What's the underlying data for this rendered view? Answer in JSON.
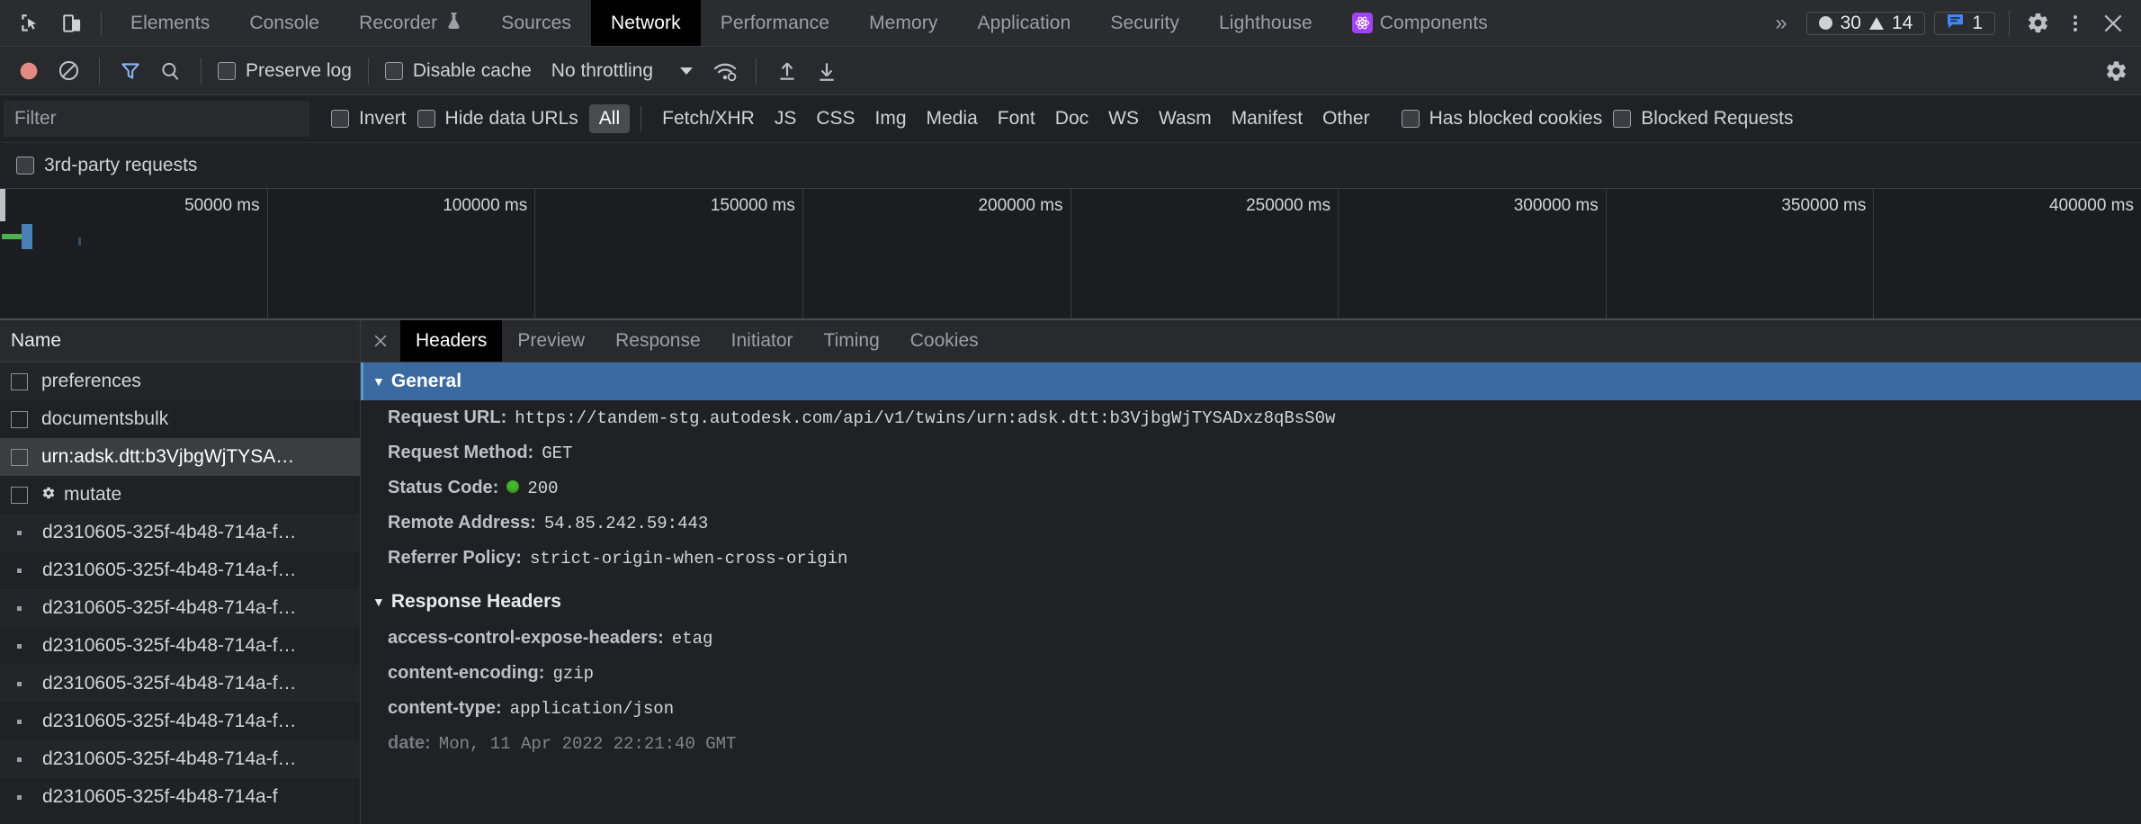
{
  "toolbar": {
    "inspect_icon": "inspect-element-icon",
    "device_icon": "device-toolbar-icon",
    "tabs": [
      {
        "label": "Elements",
        "selected": false
      },
      {
        "label": "Console",
        "selected": false
      },
      {
        "label": "Recorder",
        "selected": false,
        "badge": "flask-icon"
      },
      {
        "label": "Sources",
        "selected": false
      },
      {
        "label": "Network",
        "selected": true
      },
      {
        "label": "Performance",
        "selected": false
      },
      {
        "label": "Memory",
        "selected": false
      },
      {
        "label": "Application",
        "selected": false
      },
      {
        "label": "Security",
        "selected": false
      },
      {
        "label": "Lighthouse",
        "selected": false
      },
      {
        "label": "Components",
        "selected": false,
        "icon": "react-components-icon"
      }
    ],
    "more_tabs": "»",
    "error_count": "30",
    "warning_count": "14",
    "info_count": "1",
    "settings_icon": "gear-icon",
    "more_icon": "kebab-menu-icon",
    "close_icon": "close-icon"
  },
  "network_toolbar": {
    "record_icon": "record-button-icon",
    "clear_icon": "clear-requests-icon",
    "filter_icon": "filter-funnel-icon",
    "search_icon": "search-icon",
    "preserve_log": {
      "label": "Preserve log",
      "checked": false
    },
    "disable_cache": {
      "label": "Disable cache",
      "checked": false
    },
    "throttling": {
      "value": "No throttling"
    },
    "wifi_icon": "network-conditions-icon",
    "import_icon": "import-har-icon",
    "export_icon": "export-har-icon",
    "settings_icon": "network-settings-gear-icon"
  },
  "filter_bar": {
    "input_placeholder": "Filter",
    "input_value": "",
    "invert": {
      "label": "Invert",
      "checked": false
    },
    "hide_data_urls": {
      "label": "Hide data URLs",
      "checked": false
    },
    "types": [
      {
        "label": "All",
        "active": true
      },
      {
        "label": "Fetch/XHR",
        "active": false
      },
      {
        "label": "JS",
        "active": false
      },
      {
        "label": "CSS",
        "active": false
      },
      {
        "label": "Img",
        "active": false
      },
      {
        "label": "Media",
        "active": false
      },
      {
        "label": "Font",
        "active": false
      },
      {
        "label": "Doc",
        "active": false
      },
      {
        "label": "WS",
        "active": false
      },
      {
        "label": "Wasm",
        "active": false
      },
      {
        "label": "Manifest",
        "active": false
      },
      {
        "label": "Other",
        "active": false
      }
    ],
    "has_blocked_cookies": {
      "label": "Has blocked cookies",
      "checked": false
    },
    "blocked_requests": {
      "label": "Blocked Requests",
      "checked": false
    },
    "third_party": {
      "label": "3rd-party requests",
      "checked": false
    }
  },
  "overview": {
    "ticks": [
      "50000 ms",
      "100000 ms",
      "150000 ms",
      "200000 ms",
      "250000 ms",
      "300000 ms",
      "350000 ms",
      "400000 ms"
    ],
    "colors": {
      "waiting": "#4caf50",
      "download": "#4a7fb5"
    }
  },
  "request_list": {
    "column_header": "Name",
    "rows": [
      {
        "name": "preferences",
        "marker": "checkbox",
        "selected": false
      },
      {
        "name": "documentsbulk",
        "marker": "checkbox",
        "selected": false
      },
      {
        "name": "urn:adsk.dtt:b3VjbgWjTYSA…",
        "marker": "checkbox",
        "selected": true
      },
      {
        "name": "mutate",
        "marker": "checkbox",
        "icon": "gear-icon",
        "selected": false
      },
      {
        "name": "d2310605-325f-4b48-714a-f…",
        "marker": "dot",
        "selected": false
      },
      {
        "name": "d2310605-325f-4b48-714a-f…",
        "marker": "dot",
        "selected": false
      },
      {
        "name": "d2310605-325f-4b48-714a-f…",
        "marker": "dot",
        "selected": false
      },
      {
        "name": "d2310605-325f-4b48-714a-f…",
        "marker": "dot",
        "selected": false
      },
      {
        "name": "d2310605-325f-4b48-714a-f…",
        "marker": "dot",
        "selected": false
      },
      {
        "name": "d2310605-325f-4b48-714a-f…",
        "marker": "dot",
        "selected": false
      },
      {
        "name": "d2310605-325f-4b48-714a-f…",
        "marker": "dot",
        "selected": false
      },
      {
        "name": "d2310605-325f-4b48-714a-f",
        "marker": "dot",
        "selected": false
      }
    ]
  },
  "details": {
    "close_icon": "close-icon",
    "tabs": [
      {
        "label": "Headers",
        "selected": true
      },
      {
        "label": "Preview",
        "selected": false
      },
      {
        "label": "Response",
        "selected": false
      },
      {
        "label": "Initiator",
        "selected": false
      },
      {
        "label": "Timing",
        "selected": false
      },
      {
        "label": "Cookies",
        "selected": false
      }
    ],
    "sections": [
      {
        "title": "General",
        "highlighted": true,
        "rows": [
          {
            "key": "Request URL:",
            "value": "https://tandem-stg.autodesk.com/api/v1/twins/urn:adsk.dtt:b3VjbgWjTYSADxz8qBsS0w"
          },
          {
            "key": "Request Method:",
            "value": "GET"
          },
          {
            "key": "Status Code:",
            "value": "200",
            "status": "ok"
          },
          {
            "key": "Remote Address:",
            "value": "54.85.242.59:443"
          },
          {
            "key": "Referrer Policy:",
            "value": "strict-origin-when-cross-origin"
          }
        ]
      },
      {
        "title": "Response Headers",
        "highlighted": false,
        "rows": [
          {
            "key": "access-control-expose-headers:",
            "value": "etag"
          },
          {
            "key": "content-encoding:",
            "value": "gzip"
          },
          {
            "key": "content-type:",
            "value": "application/json"
          },
          {
            "key": "date:",
            "value": "Mon, 11 Apr 2022 22:21:40 GMT",
            "clipped": true
          }
        ]
      }
    ]
  }
}
